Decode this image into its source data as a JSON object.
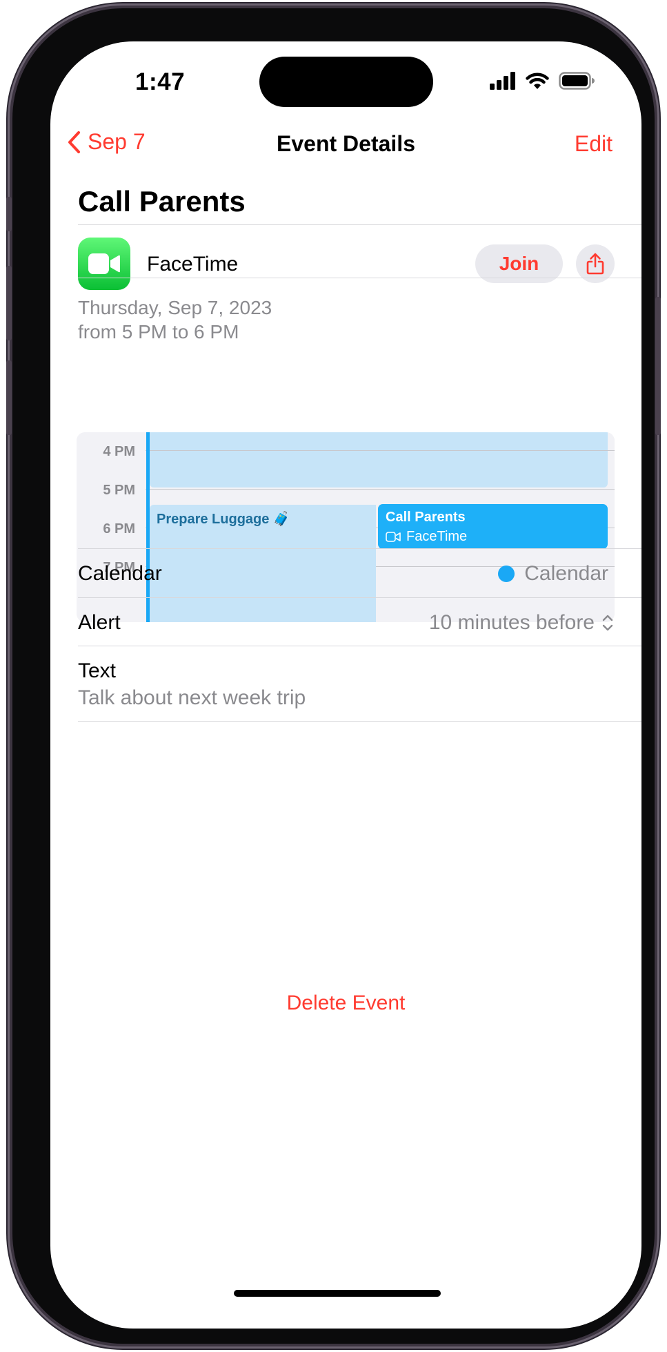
{
  "status_bar": {
    "time": "1:47"
  },
  "nav": {
    "back_label": "Sep 7",
    "title": "Event Details",
    "edit_label": "Edit"
  },
  "event": {
    "title": "Call Parents",
    "facetime_label": "FaceTime",
    "join_label": "Join",
    "date_line": "Thursday, Sep 7, 2023",
    "time_line": "from 5 PM to 6 PM"
  },
  "mini_calendar": {
    "hours": [
      "4 PM",
      "5 PM",
      "6 PM",
      "7 PM"
    ],
    "events": [
      {
        "title": "Prepare Luggage 🧳"
      },
      {
        "title": "Call Parents",
        "subtitle": "FaceTime"
      }
    ],
    "accent_color": "#1aa8f5"
  },
  "details": {
    "calendar_label": "Calendar",
    "calendar_value": "Calendar",
    "alert_label": "Alert",
    "alert_value": "10 minutes before",
    "notes_label": "Text",
    "notes_value": "Talk about next week trip"
  },
  "actions": {
    "delete_label": "Delete Event"
  },
  "colors": {
    "accent": "#ff3b30",
    "calendar_blue": "#1aa8f5",
    "facetime_green": "#2bd651"
  }
}
